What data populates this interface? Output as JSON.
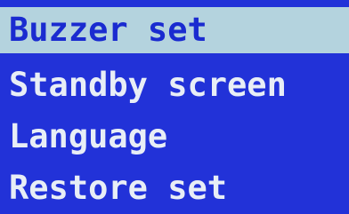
{
  "menu": {
    "items": [
      {
        "label": "Buzzer set",
        "selected": true
      },
      {
        "label": "Standby screen",
        "selected": false
      },
      {
        "label": "Language",
        "selected": false
      },
      {
        "label": "Restore set",
        "selected": false
      }
    ]
  },
  "colors": {
    "background": "#2232d8",
    "selected_background": "#b4d3de",
    "selected_text": "#1a2bd0",
    "text": "#e8eef6"
  }
}
